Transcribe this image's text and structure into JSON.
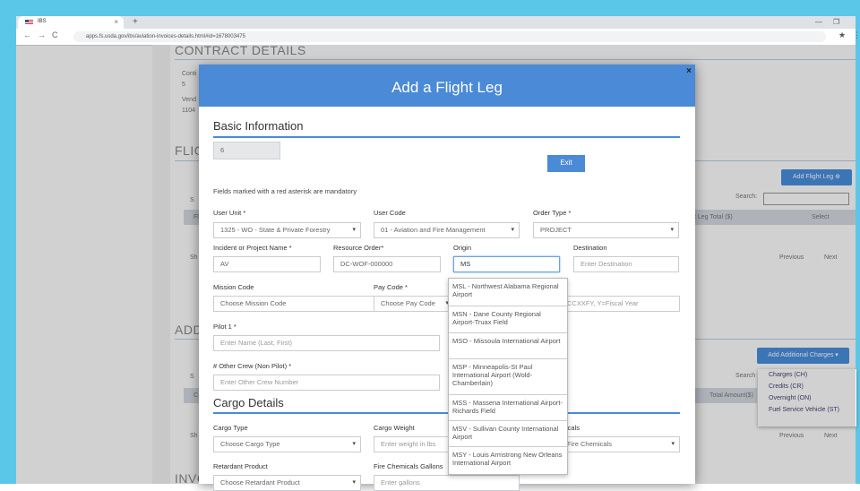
{
  "browser": {
    "tab_title": "IBS",
    "tab_close": "×",
    "new_tab": "+",
    "minimize": "—",
    "maximize": "❐",
    "back": "←",
    "forward": "→",
    "reload": "C",
    "url": "apps.fs.usda.gov/ibs/aviation-invoices-details.html#id=1678003475",
    "bookmark": "★",
    "menu": "⋮"
  },
  "page": {
    "contract_details_heading": "CONTRACT DETAILS",
    "contract_label": "Conti",
    "contract_value": "5",
    "vendor_label": "Vend",
    "vendor_value": "1104",
    "flight_heading_fragment": "FLIG",
    "add_flight_leg_button": "Add Flight Leg ⊕",
    "search_label": "Search:",
    "flight_table_total_header": "t Leg Total ($)",
    "flight_table_select_header": "Select",
    "flight_fragment_s": "S",
    "flight_fragment_f": "Fl",
    "flight_fragment_sh": "Sh",
    "previous": "Previous",
    "next": "Next",
    "additional_heading_fragment": "ADD",
    "add_additional_charges_button": "Add Additional Charges ▾",
    "search_label_2": "Search",
    "total_amount_header": "Total Amount($)",
    "add_fragment_s": "S",
    "add_fragment_c": "C",
    "add_fragment_sh": "Sh",
    "previous_2": "Previous",
    "next_2": "Next",
    "invoice_heading_fragment": "INVC",
    "charges_menu": [
      "Charges (CH)",
      "Credits (CR)",
      "Overnight (ON)",
      "Fuel Service Vehicle (ST)"
    ]
  },
  "modal": {
    "title": "Add a Flight Leg",
    "close": "×",
    "basic_info_heading": "Basic Information",
    "leg_number": "6",
    "exit_button": "Exit",
    "mandatory_note": "Fields marked with a red asterisk are mandatory",
    "user_unit_label": "User Unit *",
    "user_unit_value": "1325 - WO - State & Private Forestry",
    "user_code_label": "User Code",
    "user_code_value": "01 - Aviation and Fire Management",
    "order_type_label": "Order Type *",
    "order_type_value": "PROJECT",
    "incident_label": "Incident or Project Name *",
    "incident_value": "AV",
    "resource_order_label": "Resource Order*",
    "resource_order_value": "DC-WOF-000000",
    "origin_label": "Origin",
    "origin_value": "MS",
    "destination_label": "Destination",
    "destination_placeholder": "Enter Destination",
    "mission_code_label": "Mission Code",
    "mission_code_value": "Choose Mission Code",
    "pay_code_label": "Pay Code *",
    "pay_code_value": "Choose Pay Code",
    "fiscal_year_placeholder": "CCXXFY, Y=Fiscal Year",
    "pilot_label": "Pilot 1 *",
    "pilot_placeholder": "Enter Name (Last, First)",
    "other_crew_label": "# Other Crew (Non Pilot) *",
    "other_crew_placeholder": "Enter Other Crew Number",
    "cargo_heading": "Cargo Details",
    "cargo_type_label": "Cargo Type",
    "cargo_type_value": "Choose Cargo Type",
    "cargo_weight_label": "Cargo Weight",
    "cargo_weight_placeholder": "Enter weight in lbs",
    "fire_chem_label_fragment": "icals",
    "fire_chem_value": "Fire Chemicals",
    "retardant_label": "Retardant Product",
    "retardant_value": "Choose Retardant Product",
    "fire_chem_gallons_label": "Fire Chemicals Gallons",
    "fire_chem_gallons_placeholder": "Enter gallons"
  },
  "origin_dropdown": [
    "MSL - Northwest Alabama Regional Airport",
    "MSN - Dane County Regional Airport-Truax Field",
    "MSO - Missoula International Airport",
    "MSP - Minneapolis-St Paul International Airport (Wold-Chamberlain)",
    "MSS - Massena International Airport-Richards Field",
    "MSV - Sullivan County International Airport",
    "MSY - Louis Armstrong New Orleans International Airport"
  ]
}
